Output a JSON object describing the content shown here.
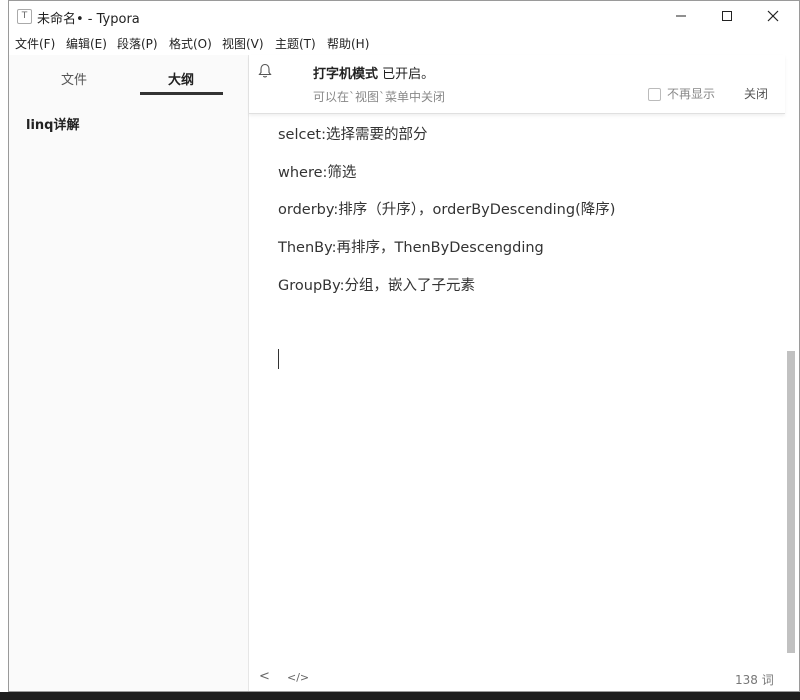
{
  "window": {
    "title": "未命名• - Typora",
    "controls": {
      "minimize": "—",
      "maximize": "☐",
      "close": "✕"
    }
  },
  "menubar": [
    "文件(F)",
    "编辑(E)",
    "段落(P)",
    "格式(O)",
    "视图(V)",
    "主题(T)",
    "帮助(H)"
  ],
  "sidebar": {
    "tabs": [
      "文件",
      "大纲"
    ],
    "active_tab": "大纲",
    "outline": [
      "linq详解"
    ]
  },
  "notification": {
    "title_bold": "打字机模式",
    "title_rest": " 已开启。",
    "subtitle": "可以在`视图`菜单中关闭",
    "checkbox_label": "不再显示",
    "close_label": "关闭"
  },
  "editor": {
    "paragraphs": [
      "selcet:选择需要的部分",
      "where:筛选",
      "orderby:排序（升序），orderByDescending(降序)",
      "ThenBy:再排序，ThenByDescengding",
      "GroupBy:分组，嵌入了子元素"
    ]
  },
  "statusbar": {
    "back_icon": "<",
    "source_icon": "</>",
    "word_count": "138 词"
  }
}
